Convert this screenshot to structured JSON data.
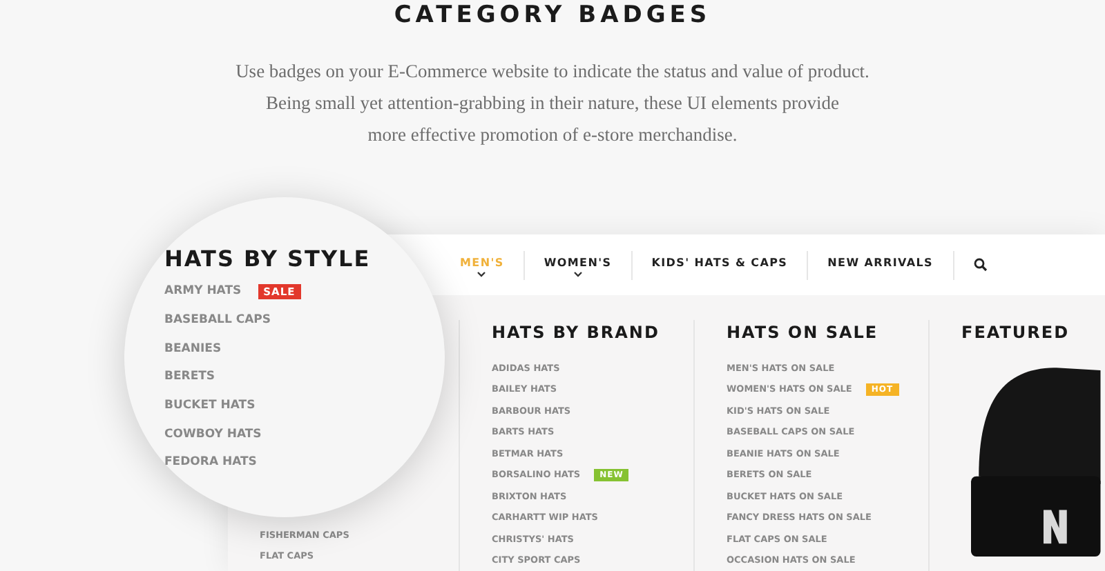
{
  "heading": "CATEGORY BADGES",
  "intro": [
    "Use badges on your E-Commerce website to indicate the status and value of product.",
    "Being small yet attention-grabbing in their nature, these UI elements provide",
    "more effective promotion of e-store merchandise."
  ],
  "nav": {
    "items": [
      {
        "label": "MEN'S",
        "selected": true,
        "dropdown": true
      },
      {
        "label": "WOMEN'S",
        "selected": false,
        "dropdown": true
      },
      {
        "label": "KIDS' HATS & CAPS",
        "selected": false,
        "dropdown": false
      },
      {
        "label": "NEW ARRIVALS",
        "selected": false,
        "dropdown": false
      }
    ]
  },
  "magnifier": {
    "title": "HATS BY STYLE",
    "items": [
      {
        "label": "ARMY HATS",
        "badge": {
          "text": "SALE",
          "color": "#e2382c"
        }
      },
      {
        "label": "BASEBALL CAPS"
      },
      {
        "label": "BEANIES"
      },
      {
        "label": "BERETS"
      },
      {
        "label": "BUCKET HATS"
      },
      {
        "label": "COWBOY HATS"
      },
      {
        "label": "FEDORA HATS"
      }
    ]
  },
  "columns": [
    {
      "kind": "list",
      "items": [
        {
          "label": "FISHERMAN CAPS"
        },
        {
          "label": "FLAT CAPS"
        }
      ]
    },
    {
      "kind": "list",
      "title": "HATS BY BRAND",
      "items": [
        {
          "label": "ADIDAS HATS"
        },
        {
          "label": "BAILEY HATS"
        },
        {
          "label": "BARBOUR HATS"
        },
        {
          "label": "BARTS HATS"
        },
        {
          "label": "BETMAR HATS"
        },
        {
          "label": "BORSALINO HATS",
          "badge": {
            "text": "NEW",
            "color": "#86c232"
          }
        },
        {
          "label": "BRIXTON HATS"
        },
        {
          "label": "CARHARTT WIP HATS"
        },
        {
          "label": "CHRISTYS' HATS"
        },
        {
          "label": "CITY SPORT CAPS"
        }
      ]
    },
    {
      "kind": "list",
      "title": "HATS ON SALE",
      "items": [
        {
          "label": "MEN'S HATS ON SALE"
        },
        {
          "label": "WOMEN'S HATS ON SALE",
          "badge": {
            "text": "HOT",
            "color": "#f5b325"
          }
        },
        {
          "label": "KID'S HATS ON SALE"
        },
        {
          "label": "BASEBALL CAPS ON SALE"
        },
        {
          "label": "BEANIE HATS ON SALE"
        },
        {
          "label": "BERETS ON SALE"
        },
        {
          "label": "BUCKET HATS ON SALE"
        },
        {
          "label": "FANCY DRESS HATS ON SALE"
        },
        {
          "label": "FLAT CAPS ON SALE"
        },
        {
          "label": "OCCASION HATS ON SALE"
        }
      ]
    },
    {
      "kind": "featured",
      "title": "FEATURED"
    }
  ]
}
